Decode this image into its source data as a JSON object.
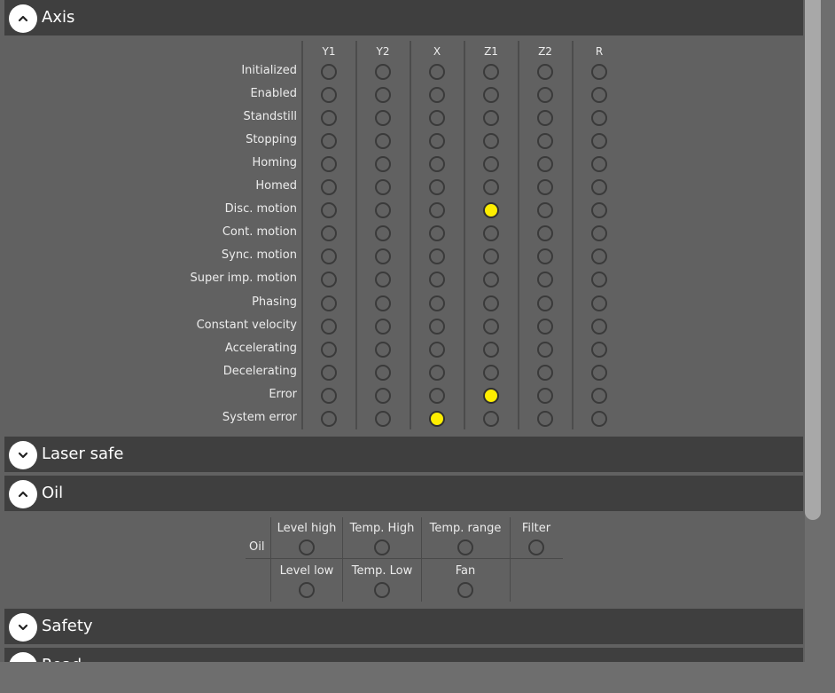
{
  "sections": {
    "axis": {
      "title": "Axis",
      "expanded": true
    },
    "laser_safe": {
      "title": "Laser safe",
      "expanded": false
    },
    "oil": {
      "title": "Oil",
      "expanded": true
    },
    "safety": {
      "title": "Safety",
      "expanded": false
    },
    "next": {
      "title": "Read… ",
      "expanded": false
    }
  },
  "axis_table": {
    "columns": [
      "Y1",
      "Y2",
      "X",
      "Z1",
      "Z2",
      "R"
    ],
    "rows": [
      {
        "label": "Initialized",
        "states": [
          0,
          0,
          0,
          0,
          0,
          0
        ]
      },
      {
        "label": "Enabled",
        "states": [
          0,
          0,
          0,
          0,
          0,
          0
        ]
      },
      {
        "label": "Standstill",
        "states": [
          0,
          0,
          0,
          0,
          0,
          0
        ]
      },
      {
        "label": "Stopping",
        "states": [
          0,
          0,
          0,
          0,
          0,
          0
        ]
      },
      {
        "label": "Homing",
        "states": [
          0,
          0,
          0,
          0,
          0,
          0
        ]
      },
      {
        "label": "Homed",
        "states": [
          0,
          0,
          0,
          0,
          0,
          0
        ]
      },
      {
        "label": "Disc. motion",
        "states": [
          0,
          0,
          0,
          1,
          0,
          0
        ]
      },
      {
        "label": "Cont. motion",
        "states": [
          0,
          0,
          0,
          0,
          0,
          0
        ]
      },
      {
        "label": "Sync. motion",
        "states": [
          0,
          0,
          0,
          0,
          0,
          0
        ]
      },
      {
        "label": "Super imp. motion",
        "states": [
          0,
          0,
          0,
          0,
          0,
          0
        ]
      },
      {
        "label": "Phasing",
        "states": [
          0,
          0,
          0,
          0,
          0,
          0
        ]
      },
      {
        "label": "Constant velocity",
        "states": [
          0,
          0,
          0,
          0,
          0,
          0
        ]
      },
      {
        "label": "Accelerating",
        "states": [
          0,
          0,
          0,
          0,
          0,
          0
        ]
      },
      {
        "label": "Decelerating",
        "states": [
          0,
          0,
          0,
          0,
          0,
          0
        ]
      },
      {
        "label": "Error",
        "states": [
          0,
          0,
          0,
          1,
          0,
          0
        ]
      },
      {
        "label": "System error",
        "states": [
          0,
          0,
          1,
          0,
          0,
          0
        ]
      }
    ]
  },
  "oil_table": {
    "row_label": "Oil",
    "row1": [
      {
        "label": "Level high",
        "on": false
      },
      {
        "label": "Temp. High",
        "on": false
      },
      {
        "label": "Temp. range",
        "on": false
      },
      {
        "label": "Filter",
        "on": false
      }
    ],
    "row2": [
      {
        "label": "Level low",
        "on": false
      },
      {
        "label": "Temp. Low",
        "on": false
      },
      {
        "label": "Fan",
        "on": false
      }
    ]
  },
  "colors": {
    "led_on": "#ffee00",
    "header_bg": "#3f3f3f",
    "panel_bg": "#616161"
  },
  "icons": {
    "expanded": "chevron-up-icon",
    "collapsed": "chevron-down-icon"
  }
}
